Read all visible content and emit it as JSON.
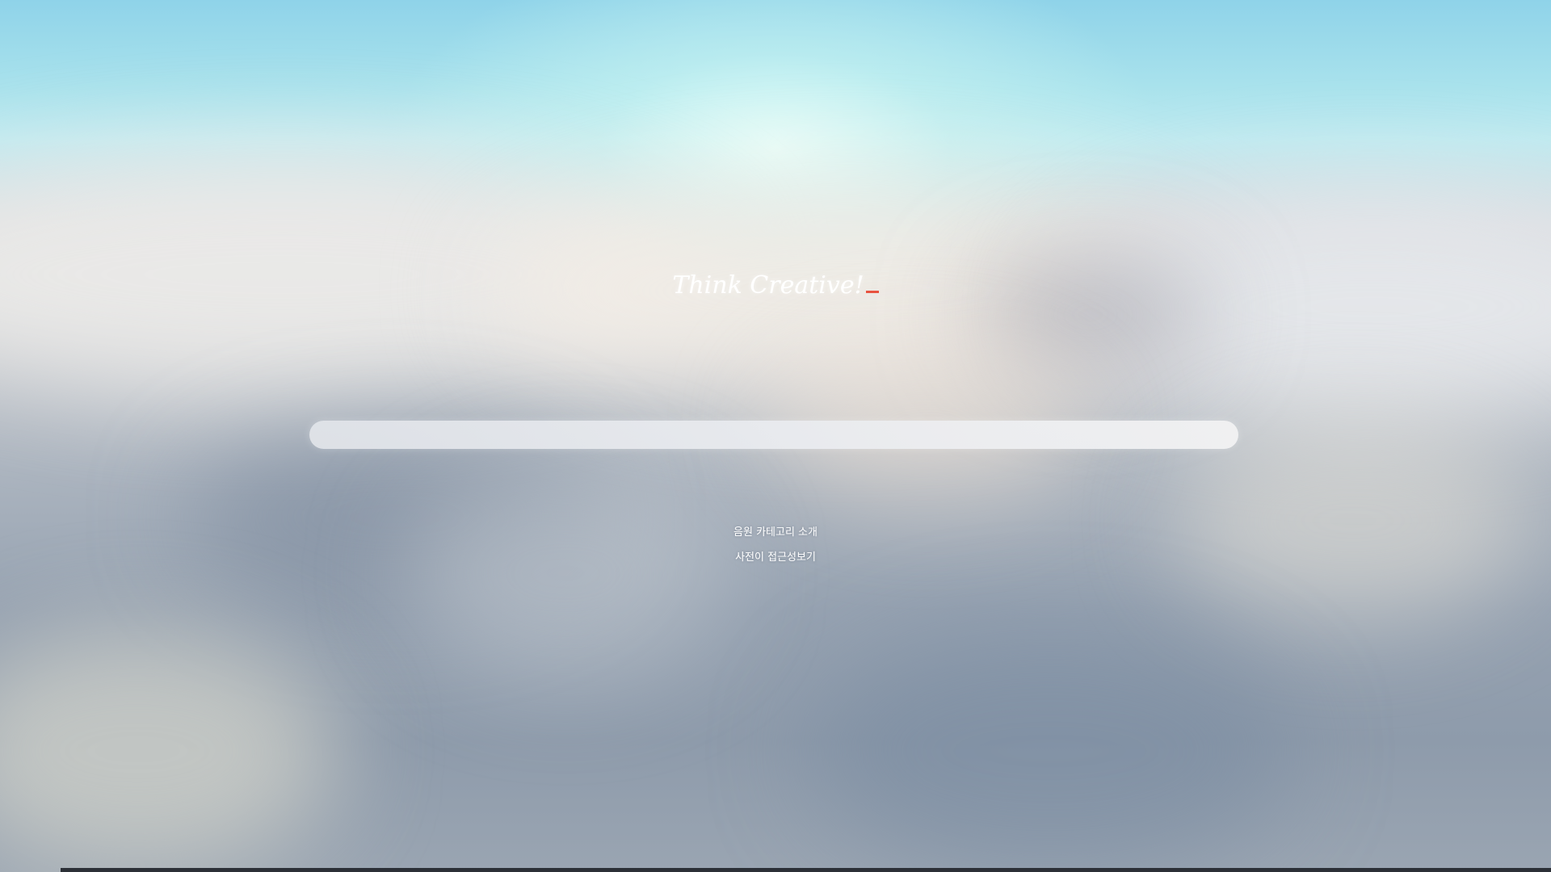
{
  "tagline": {
    "text": "Think Creative!"
  },
  "search": {
    "value": "",
    "placeholder": ""
  },
  "links": [
    {
      "label": "음원 카테고리 소개"
    },
    {
      "label": "사전이 접근성보기"
    }
  ],
  "colors": {
    "cursor_accent": "#e8523f",
    "search_bar": "#e6e8ec",
    "text": "#ffffff"
  }
}
